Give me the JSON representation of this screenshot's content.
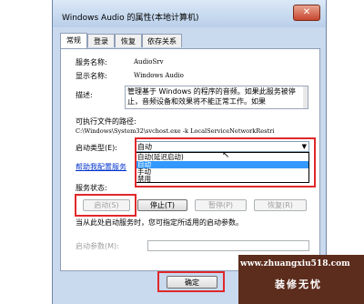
{
  "window": {
    "title": "Windows Audio 的属性(本地计算机)",
    "close": "✕"
  },
  "tabs": [
    "常规",
    "登录",
    "恢复",
    "依存关系"
  ],
  "general": {
    "service_name_label": "服务名称:",
    "service_name_value": "AudioSrv",
    "display_name_label": "显示名称:",
    "display_name_value": "Windows Audio",
    "desc_label": "描述:",
    "desc_value": "管理基于 Windows 的程序的音频。如果此服务被停止，音频设备和效果将不能正常工作。如果",
    "path_label": "可执行文件的路径:",
    "path_value": "C:\\Windows\\System32\\svchost.exe -k LocalServiceNetworkRestri",
    "startup_type_label": "启动类型(E):",
    "startup_type_value": "自动",
    "startup_options": [
      "自动(延迟启动)",
      "自动",
      "手动",
      "禁用"
    ],
    "help_link": "帮助我配置服务",
    "service_status_label": "服务状态:",
    "btn_start": "启动(S)",
    "btn_stop": "停止(T)",
    "btn_pause": "暂停(P)",
    "btn_resume": "恢复(R)",
    "hint": "当从此处启动服务时，您可指定所适用的启动参数。",
    "params_label": "启动参数(M):",
    "btn_ok": "确定"
  },
  "watermark": {
    "url": "www.zhuangxiu518.com",
    "name": "装修无忧"
  },
  "colors": {
    "highlight": "#e0282a",
    "selection": "#3399ff",
    "link": "#0033cc"
  }
}
